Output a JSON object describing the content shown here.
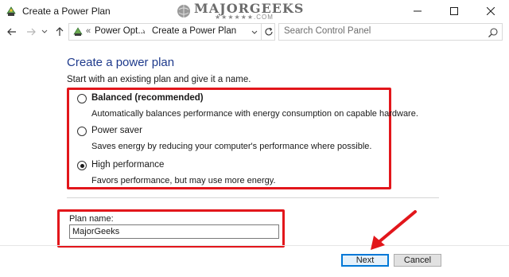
{
  "window": {
    "title": "Create a Power Plan",
    "watermark": "MAJORGEEKS",
    "watermark_sub": "★★★★★★.COM"
  },
  "nav": {
    "path_prefix": "«",
    "breadcrumb": [
      "Power Opt...",
      "Create a Power Plan"
    ],
    "search_placeholder": "Search Control Panel"
  },
  "content": {
    "heading": "Create a power plan",
    "intro": "Start with an existing plan and give it a name.",
    "plans": [
      {
        "name": "Balanced (recommended)",
        "description": "Automatically balances performance with energy consumption on capable hardware.",
        "selected": false,
        "bold": true
      },
      {
        "name": "Power saver",
        "description": "Saves energy by reducing your computer's performance where possible.",
        "selected": false,
        "bold": false
      },
      {
        "name": "High performance",
        "description": "Favors performance, but may use more energy.",
        "selected": true,
        "bold": false
      }
    ],
    "plan_name_label": "Plan name:",
    "plan_name_value": "MajorGeeks"
  },
  "buttons": {
    "next": "Next",
    "cancel": "Cancel"
  },
  "colors": {
    "highlight": "#e2161b",
    "heading": "#1e3a8c",
    "default_button_border": "#0078d7"
  }
}
